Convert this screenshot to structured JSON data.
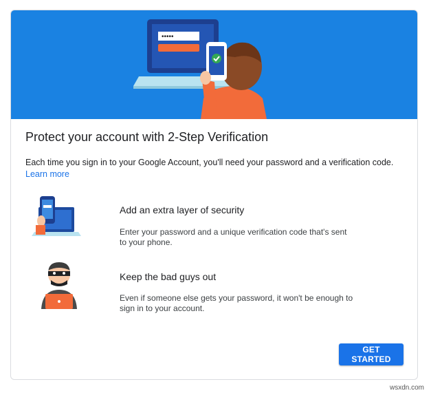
{
  "card": {
    "title": "Protect your account with 2-Step Verification",
    "description": "Each time you sign in to your Google Account, you'll need your password and a verification code.",
    "learn_more": "Learn more"
  },
  "features": [
    {
      "icon": "phone-laptop-icon",
      "title": "Add an extra layer of security",
      "body": "Enter your password and a unique verification code that's sent to your phone."
    },
    {
      "icon": "bad-guy-icon",
      "title": "Keep the bad guys out",
      "body": "Even if someone else gets your password, it won't be enough to sign in to your account."
    }
  ],
  "actions": {
    "get_started": "GET STARTED"
  },
  "hero": {
    "password_mask": "•••••"
  },
  "watermark": "wsxdn.com",
  "colors": {
    "hero_bg": "#1a82e2",
    "accent": "#1a73e8",
    "person_shirt": "#f26b3a"
  }
}
